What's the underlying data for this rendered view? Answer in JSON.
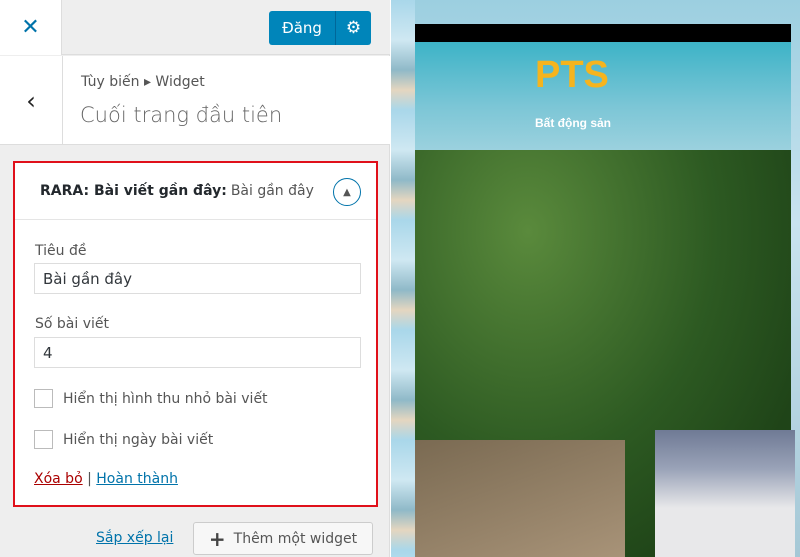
{
  "topbar": {
    "close_icon": "close-icon",
    "publish_label": "Đăng",
    "settings_icon": "gear-icon"
  },
  "header": {
    "breadcrumb": "Tùy biến ▸ Widget",
    "title": "Cuối trang đầu tiên",
    "back_icon": "chevron-left-icon"
  },
  "widget": {
    "title_prefix": "RARA: Bài viết gần đây:",
    "title_suffix": "Bài gần đây",
    "fields": [
      {
        "label": "Tiêu đề",
        "value": "Bài gần đây"
      },
      {
        "label": "Số bài viết",
        "value": "4"
      }
    ],
    "checkboxes": [
      {
        "label": "Hiển thị hình thu nhỏ bài viết",
        "checked": false
      },
      {
        "label": "Hiển thị ngày bài viết",
        "checked": false
      }
    ],
    "delete_label": "Xóa bỏ",
    "separator": "|",
    "done_label": "Hoàn thành"
  },
  "footer": {
    "reorder_label": "Sắp xếp lại",
    "add_label": "Thêm một widget"
  },
  "preview": {
    "logo": "PTS",
    "tagline": "Bất động sản"
  },
  "colors": {
    "accent": "#0085ba",
    "highlight_border": "#e0101a",
    "logo": "#f5b41e"
  }
}
